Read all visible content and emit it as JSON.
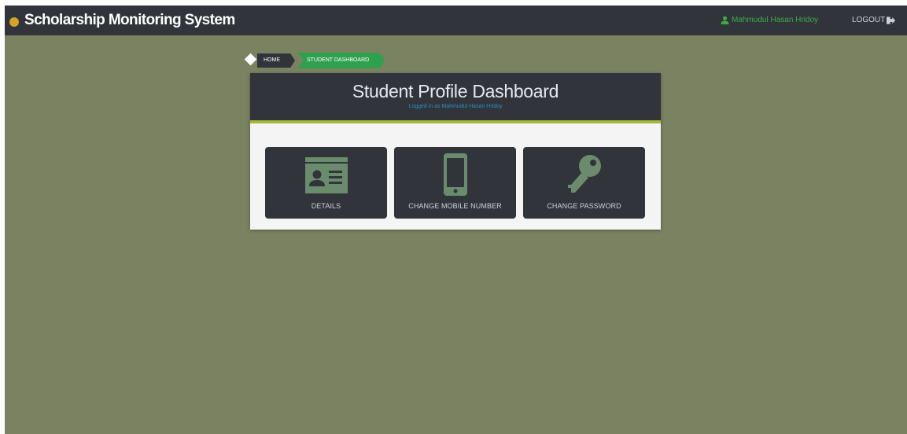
{
  "navbar": {
    "brand": "Scholarship Monitoring System",
    "user_name": "Mahmudul Hasan Hridoy",
    "logout_label": "LOGOUT"
  },
  "breadcrumb": {
    "home": "HOME",
    "current": "STUDENT DASHBOARD"
  },
  "panel": {
    "title": "Student Profile Dashboard",
    "subtitle": "Logged in as Mahmudul Hasan Hridoy"
  },
  "tiles": [
    {
      "label": "DETAILS",
      "icon": "id-card-icon"
    },
    {
      "label": "CHANGE MOBILE NUMBER",
      "icon": "mobile-phone-icon"
    },
    {
      "label": "CHANGE PASSWORD",
      "icon": "key-icon"
    }
  ],
  "colors": {
    "page_background": "#7b8262",
    "navbar": "#31343b",
    "brand_icon": "#d6a228",
    "user_link": "#3faa45",
    "breadcrumb_active": "#2fa14e",
    "header_underline": "#a6b73a",
    "tile_icon": "#6a8b6c",
    "subtitle_link": "#2f8ec4"
  }
}
